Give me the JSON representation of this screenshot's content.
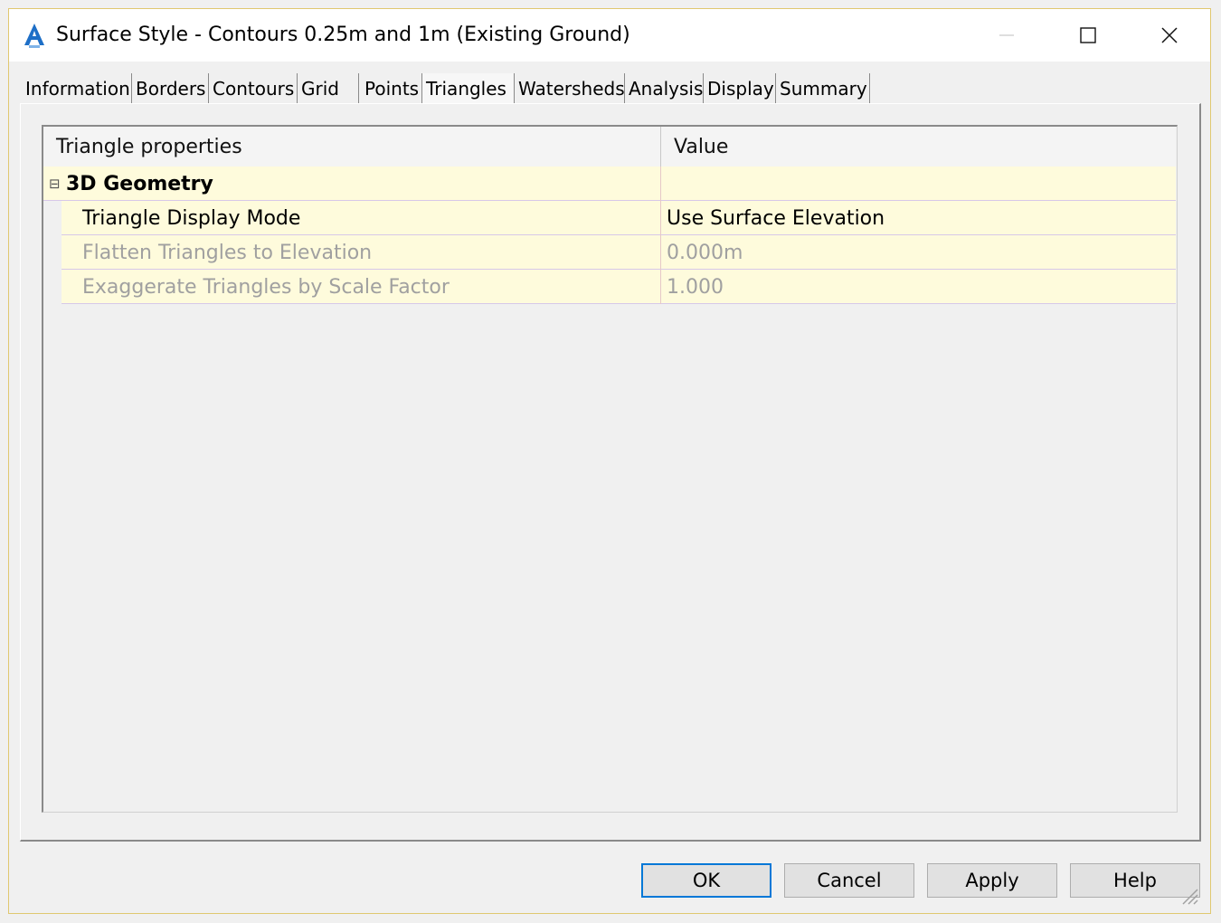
{
  "window": {
    "title": "Surface Style - Contours 0.25m and 1m (Existing Ground)",
    "minimize": "—",
    "maximize": "☐",
    "close": "✕"
  },
  "tabs": [
    {
      "label": "Information"
    },
    {
      "label": "Borders"
    },
    {
      "label": "Contours"
    },
    {
      "label": "Grid"
    },
    {
      "label": "Points"
    },
    {
      "label": "Triangles"
    },
    {
      "label": "Watersheds"
    },
    {
      "label": "Analysis"
    },
    {
      "label": "Display"
    },
    {
      "label": "Summary"
    }
  ],
  "active_tab": "Triangles",
  "grid": {
    "col_property": "Triangle properties",
    "col_value": "Value",
    "group": {
      "label": "3D Geometry",
      "expander": "⊟"
    },
    "rows": [
      {
        "property": "Triangle Display Mode",
        "value": "Use Surface Elevation",
        "enabled": true
      },
      {
        "property": "Flatten Triangles to Elevation",
        "value": "0.000m",
        "enabled": false
      },
      {
        "property": "Exaggerate Triangles by Scale Factor",
        "value": "1.000",
        "enabled": false
      }
    ]
  },
  "buttons": {
    "ok": "OK",
    "cancel": "Cancel",
    "apply": "Apply",
    "help": "Help"
  },
  "icons": {
    "app": "civil3d-app-icon",
    "resize": "resize-grip-icon"
  },
  "colors": {
    "row_bg": "#fefbdc",
    "accent": "#0078d7",
    "app_icon": "#1e6fc7"
  }
}
